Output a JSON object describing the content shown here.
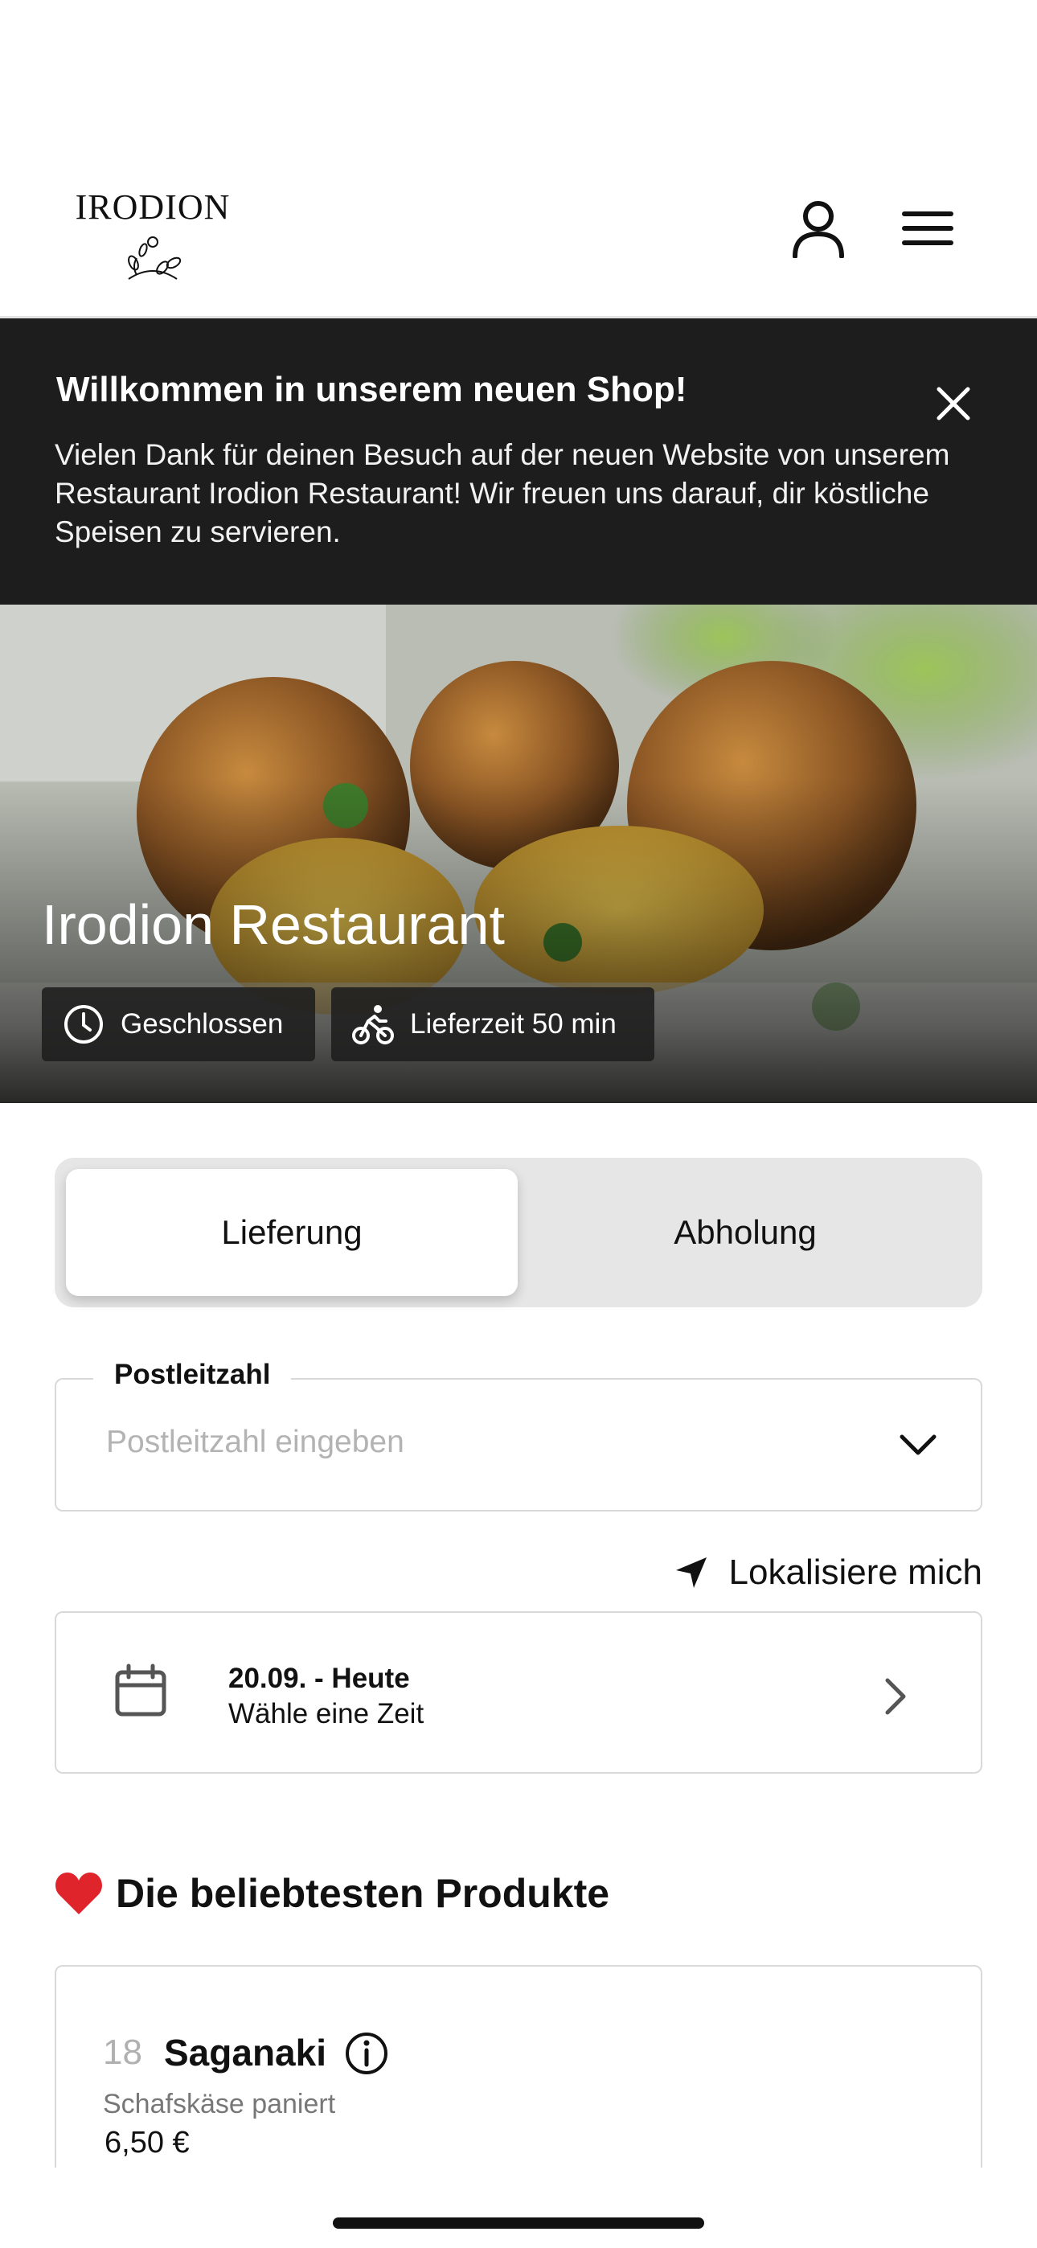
{
  "header": {
    "logo_text": "IRODION",
    "icons": {
      "account": "user-icon",
      "menu": "hamburger-menu-icon"
    }
  },
  "banner": {
    "title": "Willkommen in unserem neuen Shop!",
    "text": "Vielen Dank für deinen Besuch auf der neuen Website von unserem Restaurant Irodion Restaurant! Wir freuen uns darauf, dir köstliche Speisen zu servieren.",
    "close_icon": "close-icon"
  },
  "hero": {
    "restaurant_name": "Irodion Restaurant",
    "status": "Geschlossen",
    "delivery_time": "Lieferzeit 50 min"
  },
  "order_mode": {
    "options": [
      "Lieferung",
      "Abholung"
    ],
    "selected": "Lieferung"
  },
  "postal_code": {
    "label": "Postleitzahl",
    "placeholder": "Postleitzahl eingeben",
    "value": ""
  },
  "locate": {
    "label": "Lokalisiere mich"
  },
  "date": {
    "title": "20.09. - Heute",
    "subtitle": "Wähle eine Zeit"
  },
  "popular": {
    "heading_emoji": "❤️",
    "heading": "Die beliebtesten Produkte",
    "products": [
      {
        "number": "18",
        "name": "Saganaki",
        "description": "Schafskäse paniert",
        "price": "6,50 €"
      }
    ]
  },
  "colors": {
    "banner_bg": "#1d1d1d",
    "toggle_bg": "#e6e6e6",
    "heart": "#e0242b"
  }
}
